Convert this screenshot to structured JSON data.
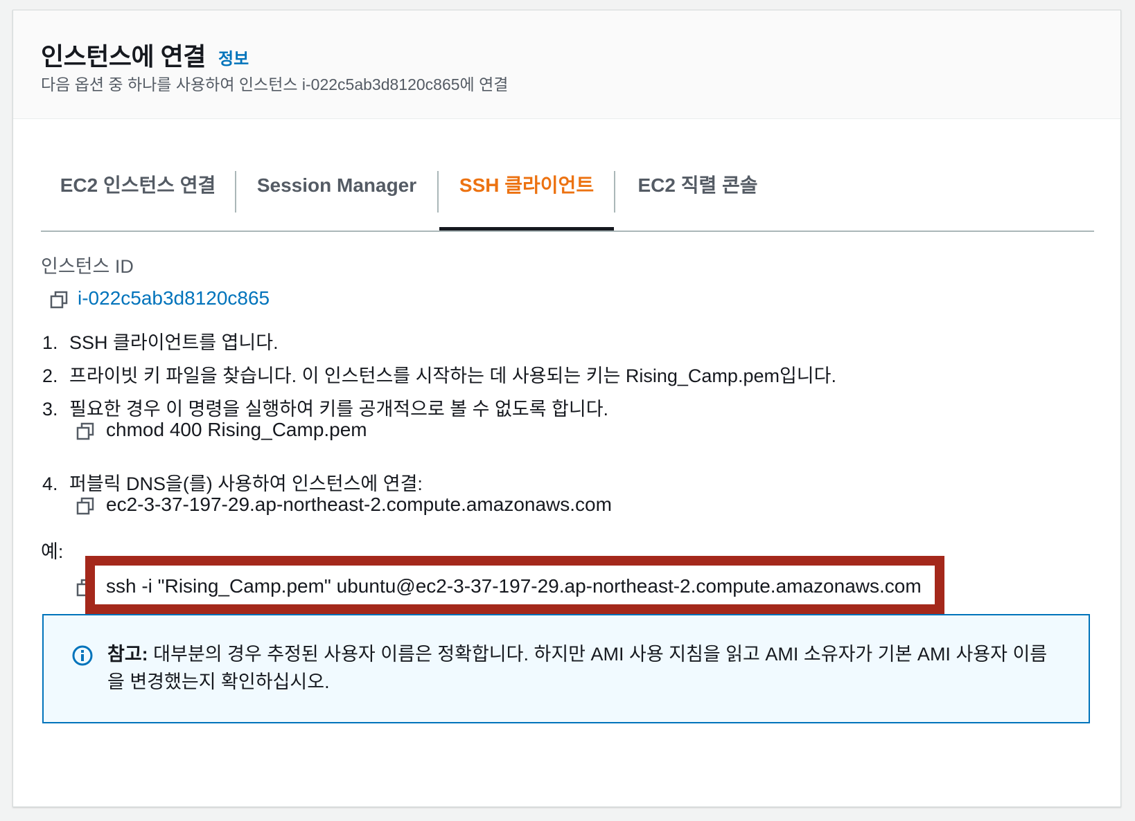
{
  "header": {
    "title": "인스턴스에 연결",
    "info_link": "정보",
    "description": "다음 옵션 중 하나를 사용하여 인스턴스 i-022c5ab3d8120c865에 연결"
  },
  "tabs": [
    {
      "label": "EC2 인스턴스 연결",
      "active": false
    },
    {
      "label": "Session Manager",
      "active": false
    },
    {
      "label": "SSH 클라이언트",
      "active": true
    },
    {
      "label": "EC2 직렬 콘솔",
      "active": false
    }
  ],
  "instance": {
    "label": "인스턴스 ID",
    "id": "i-022c5ab3d8120c865"
  },
  "steps": [
    {
      "num": "1.",
      "text": "SSH 클라이언트를 엽니다."
    },
    {
      "num": "2.",
      "text": "프라이빗 키 파일을 찾습니다. 이 인스턴스를 시작하는 데 사용되는 키는 Rising_Camp.pem입니다."
    },
    {
      "num": "3.",
      "text": "필요한 경우 이 명령을 실행하여 키를 공개적으로 볼 수 없도록 합니다."
    },
    {
      "num": "4.",
      "text": "퍼블릭 DNS을(를) 사용하여 인스턴스에 연결:"
    }
  ],
  "commands": {
    "chmod": "chmod 400 Rising_Camp.pem",
    "dns": "ec2-3-37-197-29.ap-northeast-2.compute.amazonaws.com",
    "example_label": "예:",
    "ssh": "ssh -i \"Rising_Camp.pem\" ubuntu@ec2-3-37-197-29.ap-northeast-2.compute.amazonaws.com"
  },
  "note": {
    "prefix": "참고:",
    "text": " 대부분의 경우 추정된 사용자 이름은 정확합니다. 하지만 AMI 사용 지침을 읽고 AMI 소유자가 기본 AMI 사용자 이름을 변경했는지 확인하십시오."
  },
  "icons": {
    "copy": "copy-icon",
    "info": "info-circle-icon"
  },
  "colors": {
    "link": "#0073bb",
    "active_tab": "#ec7211",
    "highlight": "#a4281b",
    "note_bg": "#f1faff"
  }
}
